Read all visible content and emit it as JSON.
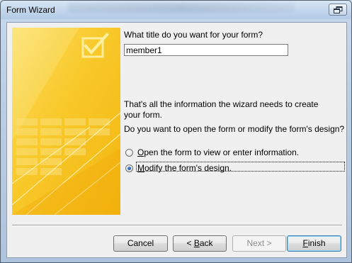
{
  "window": {
    "title": "Form Wizard"
  },
  "form": {
    "title_prompt": "What title do you want for your form?",
    "title_value": "member1",
    "info_text": "That's all the information the wizard needs to create your form.",
    "question_text": "Do you want to open the form or modify the form's design?",
    "options": [
      {
        "key": "O",
        "rest": "pen the form to view or enter information.",
        "selected": false
      },
      {
        "key": "M",
        "rest": "odify the form's design.",
        "selected": true
      }
    ]
  },
  "buttons": {
    "cancel": "Cancel",
    "back_prefix": "< ",
    "back_key": "B",
    "back_rest": "ack",
    "next": "Next >",
    "next_enabled": false,
    "finish_key": "F",
    "finish_rest": "inish"
  },
  "colors": {
    "graphic_yellow": "#f7c21e",
    "graphic_light": "#fbe27a",
    "accent_blue": "#3c7fb1"
  },
  "icons": {
    "restore": "restore-window-icon",
    "graphic": "form-checkmark-graphic"
  }
}
